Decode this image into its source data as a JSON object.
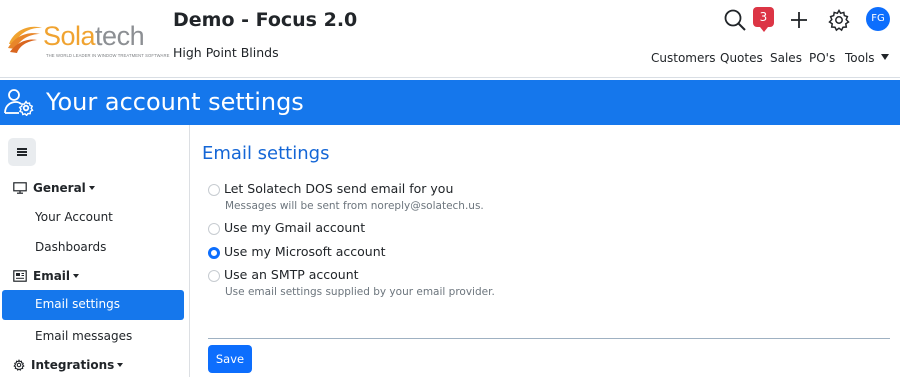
{
  "brand": {
    "name_part1": "Sola",
    "name_part2": "tech",
    "tagline": "THE WORLD LEADER IN WINDOW TREATMENT SOFTWARE",
    "orange": "#f0a330",
    "grey": "#8c8f93"
  },
  "header": {
    "app_title": "Demo - Focus 2.0",
    "company": "High Point Blinds",
    "notification_count": "3",
    "avatar_initials": "FG",
    "icons": [
      "search-icon",
      "bell-icon",
      "plus-icon",
      "gear-icon"
    ]
  },
  "nav": {
    "customers": "Customers",
    "quotes": "Quotes",
    "sales": "Sales",
    "pos": "PO's",
    "tools": "Tools"
  },
  "banner": {
    "title": "Your account settings",
    "color": "#1577ec"
  },
  "sidebar": {
    "general": "General",
    "your_account": "Your Account",
    "dashboards": "Dashboards",
    "email": "Email",
    "email_settings": "Email settings",
    "email_messages": "Email messages",
    "integrations": "Integrations"
  },
  "email_settings": {
    "title": "Email settings",
    "options": [
      {
        "label": "Let Solatech DOS send email for you",
        "hint": "Messages will be sent from noreply@solatech.us.",
        "selected": false
      },
      {
        "label": "Use my Gmail account",
        "hint": "",
        "selected": false
      },
      {
        "label": "Use my Microsoft account",
        "hint": "",
        "selected": true
      },
      {
        "label": "Use an SMTP account",
        "hint": "Use email settings supplied by your email provider.",
        "selected": false
      }
    ],
    "save_label": "Save"
  },
  "colors": {
    "primary": "#0d6efd",
    "badge": "#dc3545",
    "heading": "#1466d6"
  }
}
